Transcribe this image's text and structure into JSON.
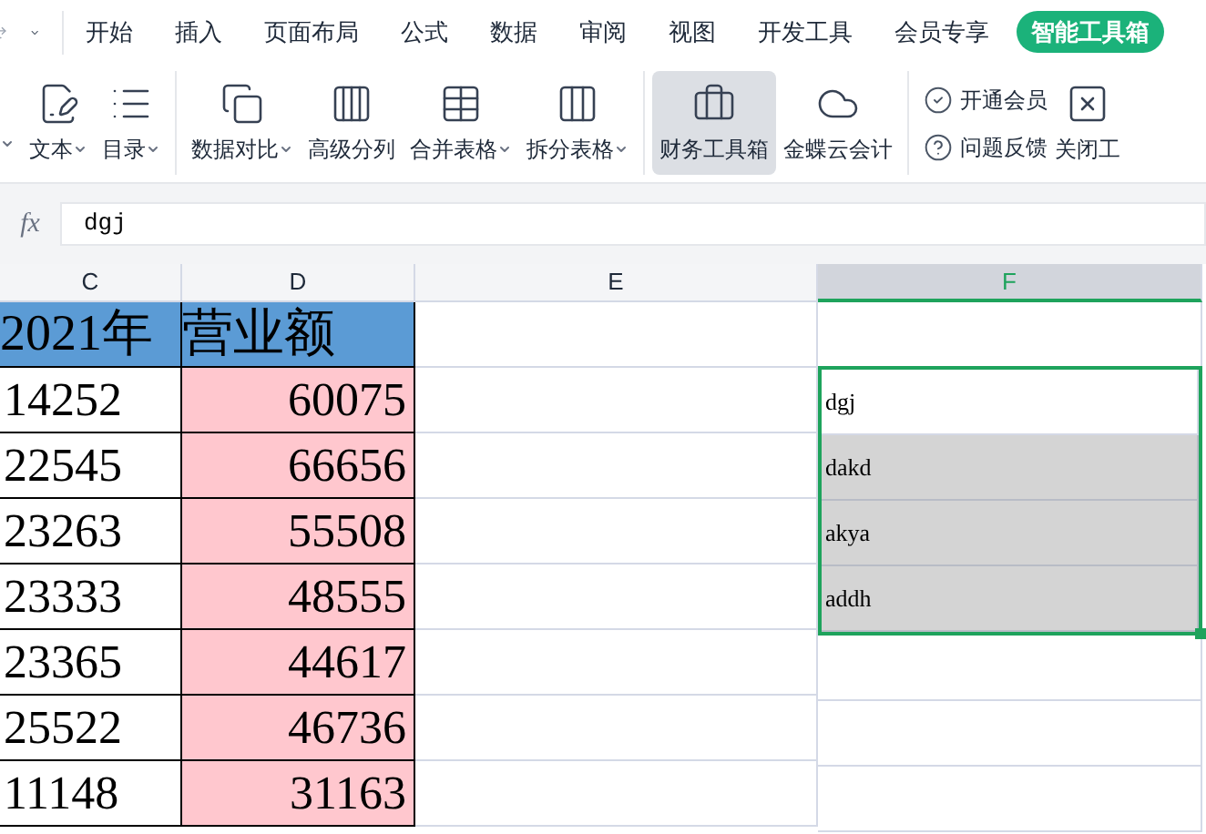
{
  "menu_tabs": [
    {
      "label": "开始",
      "selected": false
    },
    {
      "label": "插入",
      "selected": false
    },
    {
      "label": "页面布局",
      "selected": false
    },
    {
      "label": "公式",
      "selected": false
    },
    {
      "label": "数据",
      "selected": false
    },
    {
      "label": "审阅",
      "selected": false
    },
    {
      "label": "视图",
      "selected": false
    },
    {
      "label": "开发工具",
      "selected": false
    },
    {
      "label": "会员专享",
      "selected": false
    },
    {
      "label": "智能工具箱",
      "selected": true
    }
  ],
  "ribbon_groups": [
    {
      "items": [
        {
          "label": "文本",
          "dropdown": true,
          "selected": false
        },
        {
          "label": "目录",
          "dropdown": true,
          "selected": false
        }
      ]
    },
    {
      "items": [
        {
          "label": "数据对比",
          "dropdown": true,
          "selected": false
        },
        {
          "label": "高级分列",
          "dropdown": false,
          "selected": false
        },
        {
          "label": "合并表格",
          "dropdown": true,
          "selected": false
        },
        {
          "label": "拆分表格",
          "dropdown": true,
          "selected": false
        }
      ]
    },
    {
      "items": [
        {
          "label": "财务工具箱",
          "dropdown": false,
          "selected": true
        },
        {
          "label": "金蝶云会计",
          "dropdown": false,
          "selected": false
        }
      ]
    }
  ],
  "side_buttons": [
    {
      "label": "开通会员"
    },
    {
      "label": "问题反馈"
    }
  ],
  "close_button": {
    "label": "关闭工"
  },
  "formula_bar": {
    "label": "fx",
    "value": "dgj"
  },
  "columns": [
    {
      "header": "C",
      "selected": false,
      "cells": [
        {
          "text": "2021年",
          "kind": "title"
        },
        {
          "text": "14252",
          "kind": "number"
        },
        {
          "text": "22545",
          "kind": "number"
        },
        {
          "text": "23263",
          "kind": "number"
        },
        {
          "text": "23333",
          "kind": "number"
        },
        {
          "text": "23365",
          "kind": "number"
        },
        {
          "text": "25522",
          "kind": "number"
        },
        {
          "text": "11148",
          "kind": "number"
        }
      ]
    },
    {
      "header": "D",
      "selected": false,
      "cells": [
        {
          "text": "营业额",
          "kind": "title"
        },
        {
          "text": "60075",
          "kind": "highlighted"
        },
        {
          "text": "66656",
          "kind": "highlighted"
        },
        {
          "text": "55508",
          "kind": "highlighted"
        },
        {
          "text": "48555",
          "kind": "highlighted"
        },
        {
          "text": "44617",
          "kind": "highlighted"
        },
        {
          "text": "46736",
          "kind": "highlighted"
        },
        {
          "text": "31163",
          "kind": "highlighted"
        }
      ]
    },
    {
      "header": "E",
      "selected": false
    },
    {
      "header": "F",
      "selected": true,
      "cells": [
        {
          "kind": "plain",
          "selected": false,
          "active": false
        },
        {
          "text": "dgj",
          "kind": "plain",
          "selected": true,
          "active": true
        },
        {
          "text": "dakd",
          "kind": "plain",
          "selected": true,
          "active": false
        },
        {
          "text": "akya",
          "kind": "plain",
          "selected": true,
          "active": false
        },
        {
          "text": "addh",
          "kind": "plain",
          "selected": true,
          "active": false
        }
      ]
    }
  ]
}
